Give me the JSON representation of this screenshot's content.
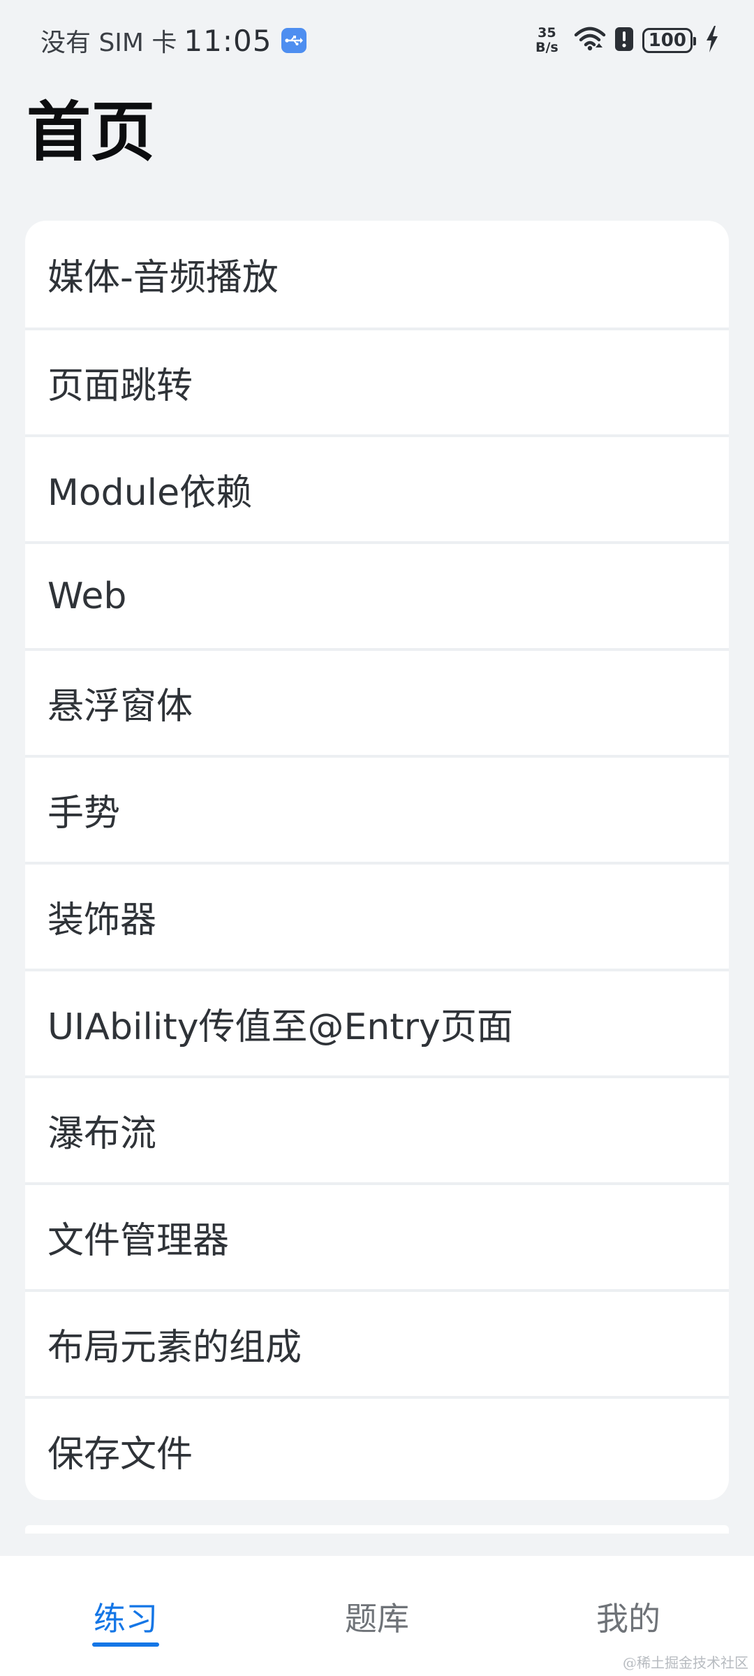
{
  "status_bar": {
    "carrier": "没有 SIM 卡",
    "time": "11:05",
    "net_speed_value": "35",
    "net_speed_unit": "B/s",
    "battery": "100",
    "usb_icon": "usb-icon",
    "wifi_icon": "wifi-icon",
    "alert_icon": "alert-icon",
    "charging_icon": "charging-bolt-icon"
  },
  "page": {
    "title": "首页"
  },
  "list": {
    "items": [
      {
        "label": "媒体-音频播放"
      },
      {
        "label": "页面跳转"
      },
      {
        "label": "Module依赖"
      },
      {
        "label": "Web"
      },
      {
        "label": "悬浮窗体"
      },
      {
        "label": "手势"
      },
      {
        "label": "装饰器"
      },
      {
        "label": "UIAbility传值至@Entry页面"
      },
      {
        "label": "瀑布流"
      },
      {
        "label": "文件管理器"
      },
      {
        "label": "布局元素的组成"
      },
      {
        "label": "保存文件"
      }
    ]
  },
  "tabs": [
    {
      "label": "练习",
      "active": true
    },
    {
      "label": "题库",
      "active": false
    },
    {
      "label": "我的",
      "active": false
    }
  ],
  "colors": {
    "accent": "#1476e6",
    "background": "#f1f3f5",
    "card": "#ffffff",
    "usb_badge": "#4e8ef0"
  },
  "watermark": "@稀土掘金技术社区"
}
